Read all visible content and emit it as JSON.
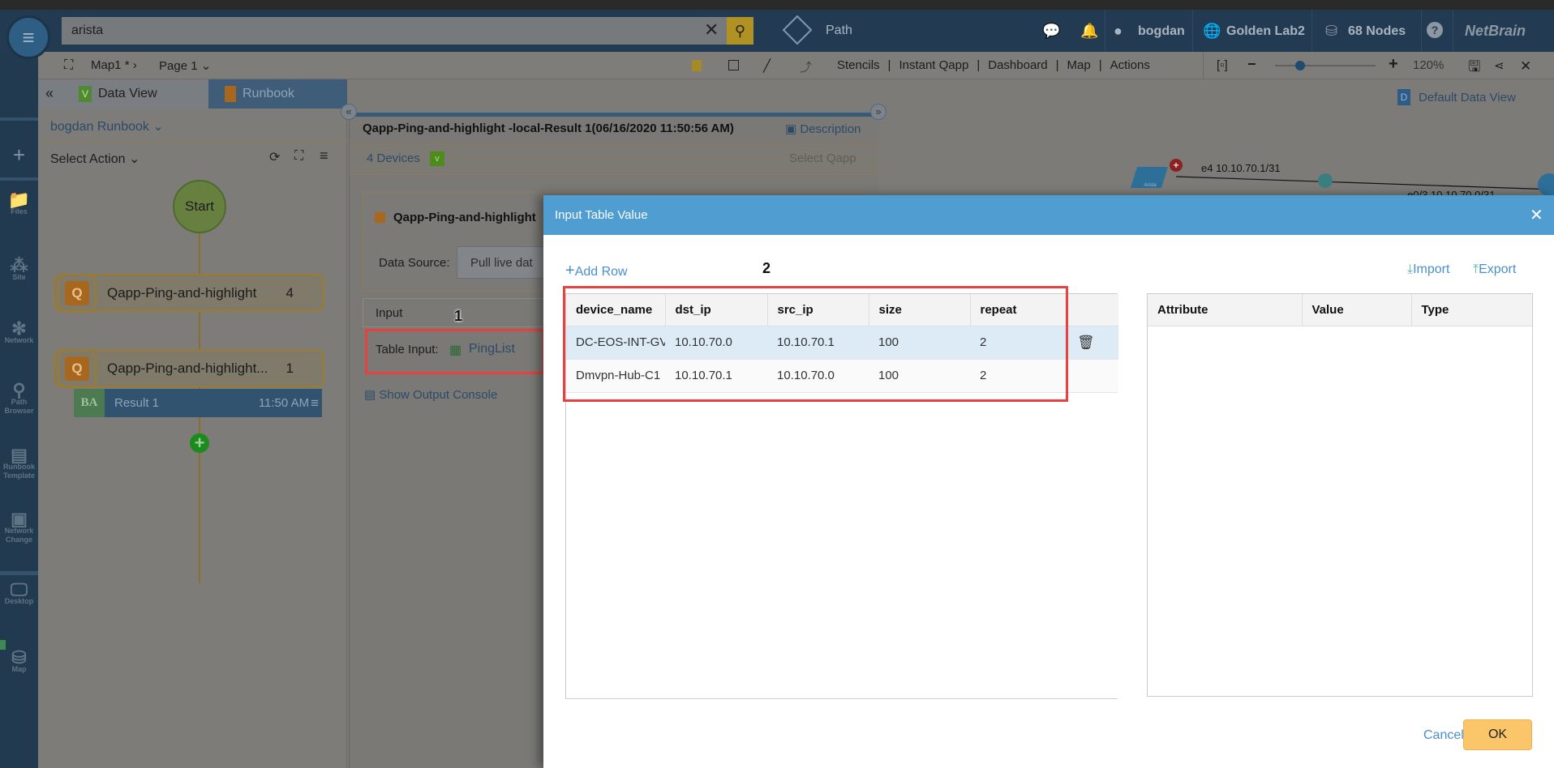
{
  "header": {
    "search_value": "arista",
    "path_label": "Path",
    "user": "bogdan",
    "domain": "Golden Lab2",
    "nodes": "68 Nodes",
    "help": "?",
    "logo": "NetBrain"
  },
  "toolbar": {
    "map_name": "Map1",
    "modified_mark": "*",
    "page": "Page 1",
    "menu": [
      "Stencils",
      "Instant Qapp",
      "Dashboard",
      "Map",
      "Actions"
    ],
    "zoom_level": "120%",
    "zoom_fraction": 0.25
  },
  "sidebar": {
    "items": [
      {
        "label": "Files",
        "icon": "folder-icon"
      },
      {
        "label": "Site",
        "icon": "site-icon"
      },
      {
        "label": "Network",
        "icon": "network-icon"
      },
      {
        "label": "Path",
        "sub": "Browser",
        "icon": "path-browser-icon"
      },
      {
        "label": "Runbook",
        "sub": "Template",
        "icon": "runbook-template-icon"
      },
      {
        "label": "Network",
        "sub": "Change",
        "icon": "network-change-icon"
      },
      {
        "label": "Desktop",
        "icon": "desktop-icon"
      },
      {
        "label": "Map",
        "icon": "map-icon"
      }
    ]
  },
  "left_panel": {
    "tabs": [
      "Data View",
      "Runbook"
    ],
    "active_tab": "Runbook",
    "runbook_name": "bogdan Runbook",
    "select_action": "Select Action",
    "flow": {
      "start": "Start",
      "nodes": [
        {
          "label": "Qapp-Ping-and-highlight",
          "count": "4"
        },
        {
          "label": "Qapp-Ping-and-highlight...",
          "count": "1"
        }
      ],
      "result": {
        "badge": "BA",
        "label": "Result 1",
        "time": "11:50 AM"
      }
    }
  },
  "mid_panel": {
    "title": "Qapp-Ping-and-highlight -local-Result 1(06/16/2020 11:50:56 AM)",
    "description": "Description",
    "devices": "4 Devices",
    "select_qapp": "Select Qapp",
    "qapp_name": "Qapp-Ping-and-highlight",
    "data_source_label": "Data Source:",
    "data_source_value": "Pull live dat",
    "input_label": "Input",
    "table_input_label": "Table Input:",
    "table_input_value": "PingList",
    "show_output": "Show Output Console",
    "callout": "1"
  },
  "map": {
    "default_data_view": "Default Data View",
    "data_view_badge": "D",
    "link_label_1": "e4 10.10.70.1/31",
    "link_label_2": "e0/3 10.10.70.0/31",
    "device_label": "Arista"
  },
  "dialog": {
    "title": "Input Table Value",
    "add_row": "Add Row",
    "import": "Import",
    "export": "Export",
    "callout": "2",
    "columns": [
      "device_name",
      "dst_ip",
      "src_ip",
      "size",
      "repeat"
    ],
    "rows": [
      [
        "DC-EOS-INT-GV",
        "10.10.70.0",
        "10.10.70.1",
        "100",
        "2"
      ],
      [
        "Dmvpn-Hub-C1",
        "10.10.70.1",
        "10.10.70.0",
        "100",
        "2"
      ]
    ],
    "attr_columns": [
      "Attribute",
      "Value",
      "Type"
    ],
    "cancel": "Cancel",
    "ok": "OK",
    "accent": "#4f9dd1",
    "ok_color": "#fbc56a"
  }
}
